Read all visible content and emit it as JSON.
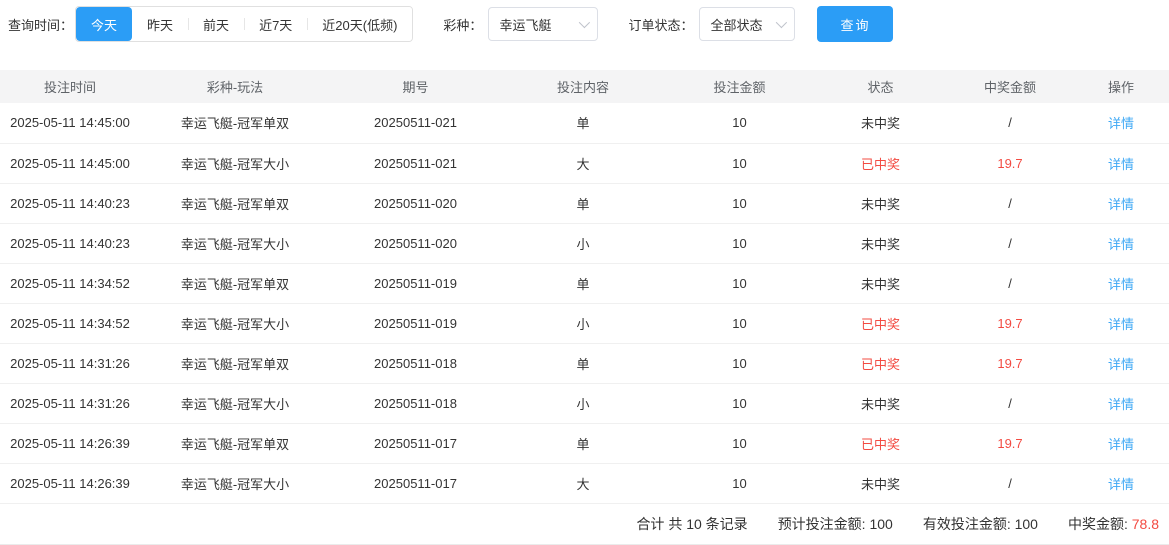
{
  "colors": {
    "accent": "#2b9df6",
    "danger": "#f34b42",
    "link": "#3ea8f5"
  },
  "filters": {
    "time_label": "查询时间：",
    "time_options": [
      {
        "label": "今天",
        "active": true
      },
      {
        "label": "昨天",
        "active": false
      },
      {
        "label": "前天",
        "active": false
      },
      {
        "label": "近7天",
        "active": false
      },
      {
        "label": "近20天(低频)",
        "active": false
      }
    ],
    "lottery_label": "彩种：",
    "lottery_value": "幸运飞艇",
    "status_label": "订单状态：",
    "status_value": "全部状态",
    "search_label": "查询"
  },
  "table": {
    "columns": [
      "投注时间",
      "彩种-玩法",
      "期号",
      "投注内容",
      "投注金额",
      "状态",
      "中奖金额",
      "操作"
    ],
    "action_label": "详情",
    "rows": [
      {
        "time": "2025-05-11 14:45:00",
        "play": "幸运飞艇-冠军单双",
        "issue": "20250511-021",
        "content": "单",
        "amount": "10",
        "status": "未中奖",
        "win": "/",
        "won": false
      },
      {
        "time": "2025-05-11 14:45:00",
        "play": "幸运飞艇-冠军大小",
        "issue": "20250511-021",
        "content": "大",
        "amount": "10",
        "status": "已中奖",
        "win": "19.7",
        "won": true
      },
      {
        "time": "2025-05-11 14:40:23",
        "play": "幸运飞艇-冠军单双",
        "issue": "20250511-020",
        "content": "单",
        "amount": "10",
        "status": "未中奖",
        "win": "/",
        "won": false
      },
      {
        "time": "2025-05-11 14:40:23",
        "play": "幸运飞艇-冠军大小",
        "issue": "20250511-020",
        "content": "小",
        "amount": "10",
        "status": "未中奖",
        "win": "/",
        "won": false
      },
      {
        "time": "2025-05-11 14:34:52",
        "play": "幸运飞艇-冠军单双",
        "issue": "20250511-019",
        "content": "单",
        "amount": "10",
        "status": "未中奖",
        "win": "/",
        "won": false
      },
      {
        "time": "2025-05-11 14:34:52",
        "play": "幸运飞艇-冠军大小",
        "issue": "20250511-019",
        "content": "小",
        "amount": "10",
        "status": "已中奖",
        "win": "19.7",
        "won": true
      },
      {
        "time": "2025-05-11 14:31:26",
        "play": "幸运飞艇-冠军单双",
        "issue": "20250511-018",
        "content": "单",
        "amount": "10",
        "status": "已中奖",
        "win": "19.7",
        "won": true
      },
      {
        "time": "2025-05-11 14:31:26",
        "play": "幸运飞艇-冠军大小",
        "issue": "20250511-018",
        "content": "小",
        "amount": "10",
        "status": "未中奖",
        "win": "/",
        "won": false
      },
      {
        "time": "2025-05-11 14:26:39",
        "play": "幸运飞艇-冠军单双",
        "issue": "20250511-017",
        "content": "单",
        "amount": "10",
        "status": "已中奖",
        "win": "19.7",
        "won": true
      },
      {
        "time": "2025-05-11 14:26:39",
        "play": "幸运飞艇-冠军大小",
        "issue": "20250511-017",
        "content": "大",
        "amount": "10",
        "status": "未中奖",
        "win": "/",
        "won": false
      }
    ]
  },
  "summary": {
    "total_text": "合计 共 10 条记录",
    "expected_label": "预计投注金额:",
    "expected_value": "100",
    "valid_label": "有效投注金额:",
    "valid_value": "100",
    "win_label": "中奖金额:",
    "win_value": "78.8"
  }
}
